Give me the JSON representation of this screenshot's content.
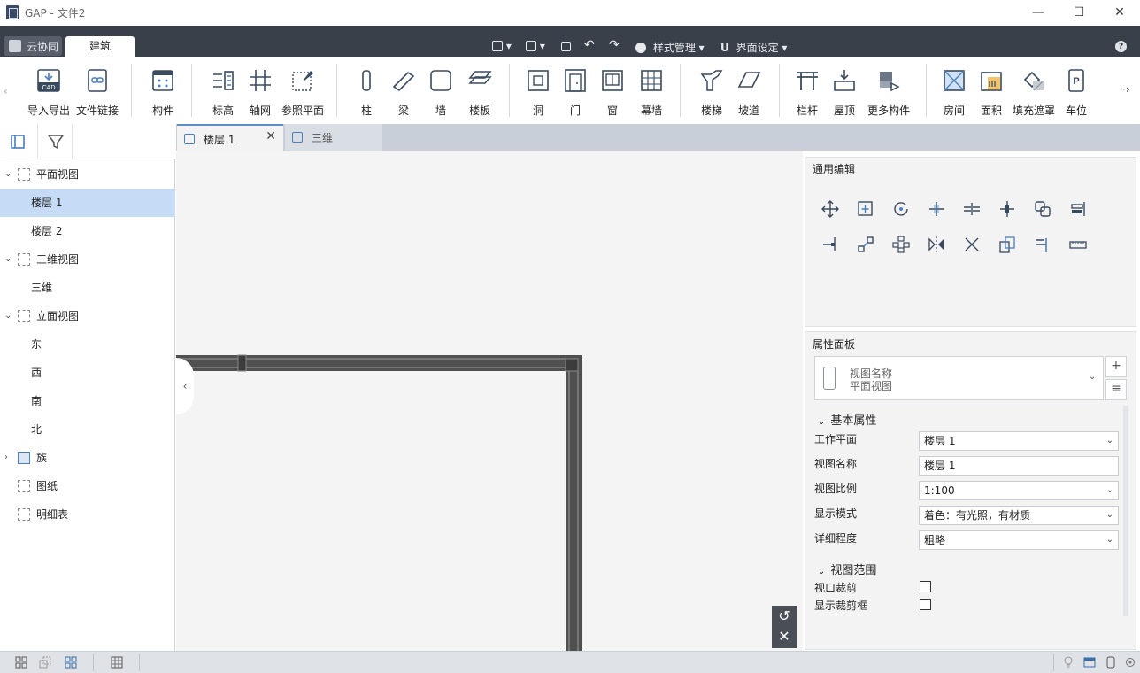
{
  "app": {
    "title": "GAP - 文件2"
  },
  "window_controls": {
    "minimize": "—",
    "maximize": "☐",
    "close": "✕"
  },
  "ribbon_tabs": {
    "cloud": "云协同",
    "architecture": "建筑"
  },
  "quick_access": {
    "style_manage": "样式管理",
    "ui_settings": "界面设定"
  },
  "ribbon": {
    "import_export": "导入导出",
    "file_link": "文件链接",
    "component": "构件",
    "level": "标高",
    "grid": "轴网",
    "ref_plane": "参照平面",
    "column": "柱",
    "beam": "梁",
    "wall": "墙",
    "slab": "楼板",
    "opening": "洞",
    "door": "门",
    "window": "窗",
    "curtain_wall": "幕墙",
    "stair": "楼梯",
    "ramp": "坡道",
    "railing": "栏杆",
    "roof": "屋顶",
    "more_components": "更多构件",
    "room": "房间",
    "area": "面积",
    "fill_mask": "填充遮罩",
    "parking": "车位",
    "cad_icon_text": "CAD"
  },
  "tree": {
    "plan_views": "平面视图",
    "floor1": "楼层 1",
    "floor2": "楼层 2",
    "views_3d": "三维视图",
    "view_3d": "三维",
    "elevation_views": "立面视图",
    "east": "东",
    "west": "西",
    "south": "南",
    "north": "北",
    "family": "族",
    "sheets": "图纸",
    "schedules": "明细表"
  },
  "doc_tabs": {
    "floor1": "楼层 1",
    "view3d": "三维"
  },
  "edit_panel": {
    "title": "通用编辑"
  },
  "properties": {
    "title": "属性面板",
    "type_line1": "视图名称",
    "type_line2": "平面视图",
    "basic_section": "基本属性",
    "work_plane_label": "工作平面",
    "work_plane_value": "楼层 1",
    "view_name_label": "视图名称",
    "view_name_value": "楼层 1",
    "scale_label": "视图比例",
    "scale_value": "1:100",
    "display_mode_label": "显示模式",
    "display_mode_value": "着色：有光照，有材质",
    "detail_label": "详细程度",
    "detail_value": "粗略",
    "range_section": "视图范围",
    "viewport_crop_label": "视口裁剪",
    "show_crop_label": "显示裁剪框"
  },
  "colors": {
    "accent": "#5c8dc7",
    "tabbar": "#3a404a",
    "selection": "#c6dcf6",
    "wall": "#505050"
  }
}
